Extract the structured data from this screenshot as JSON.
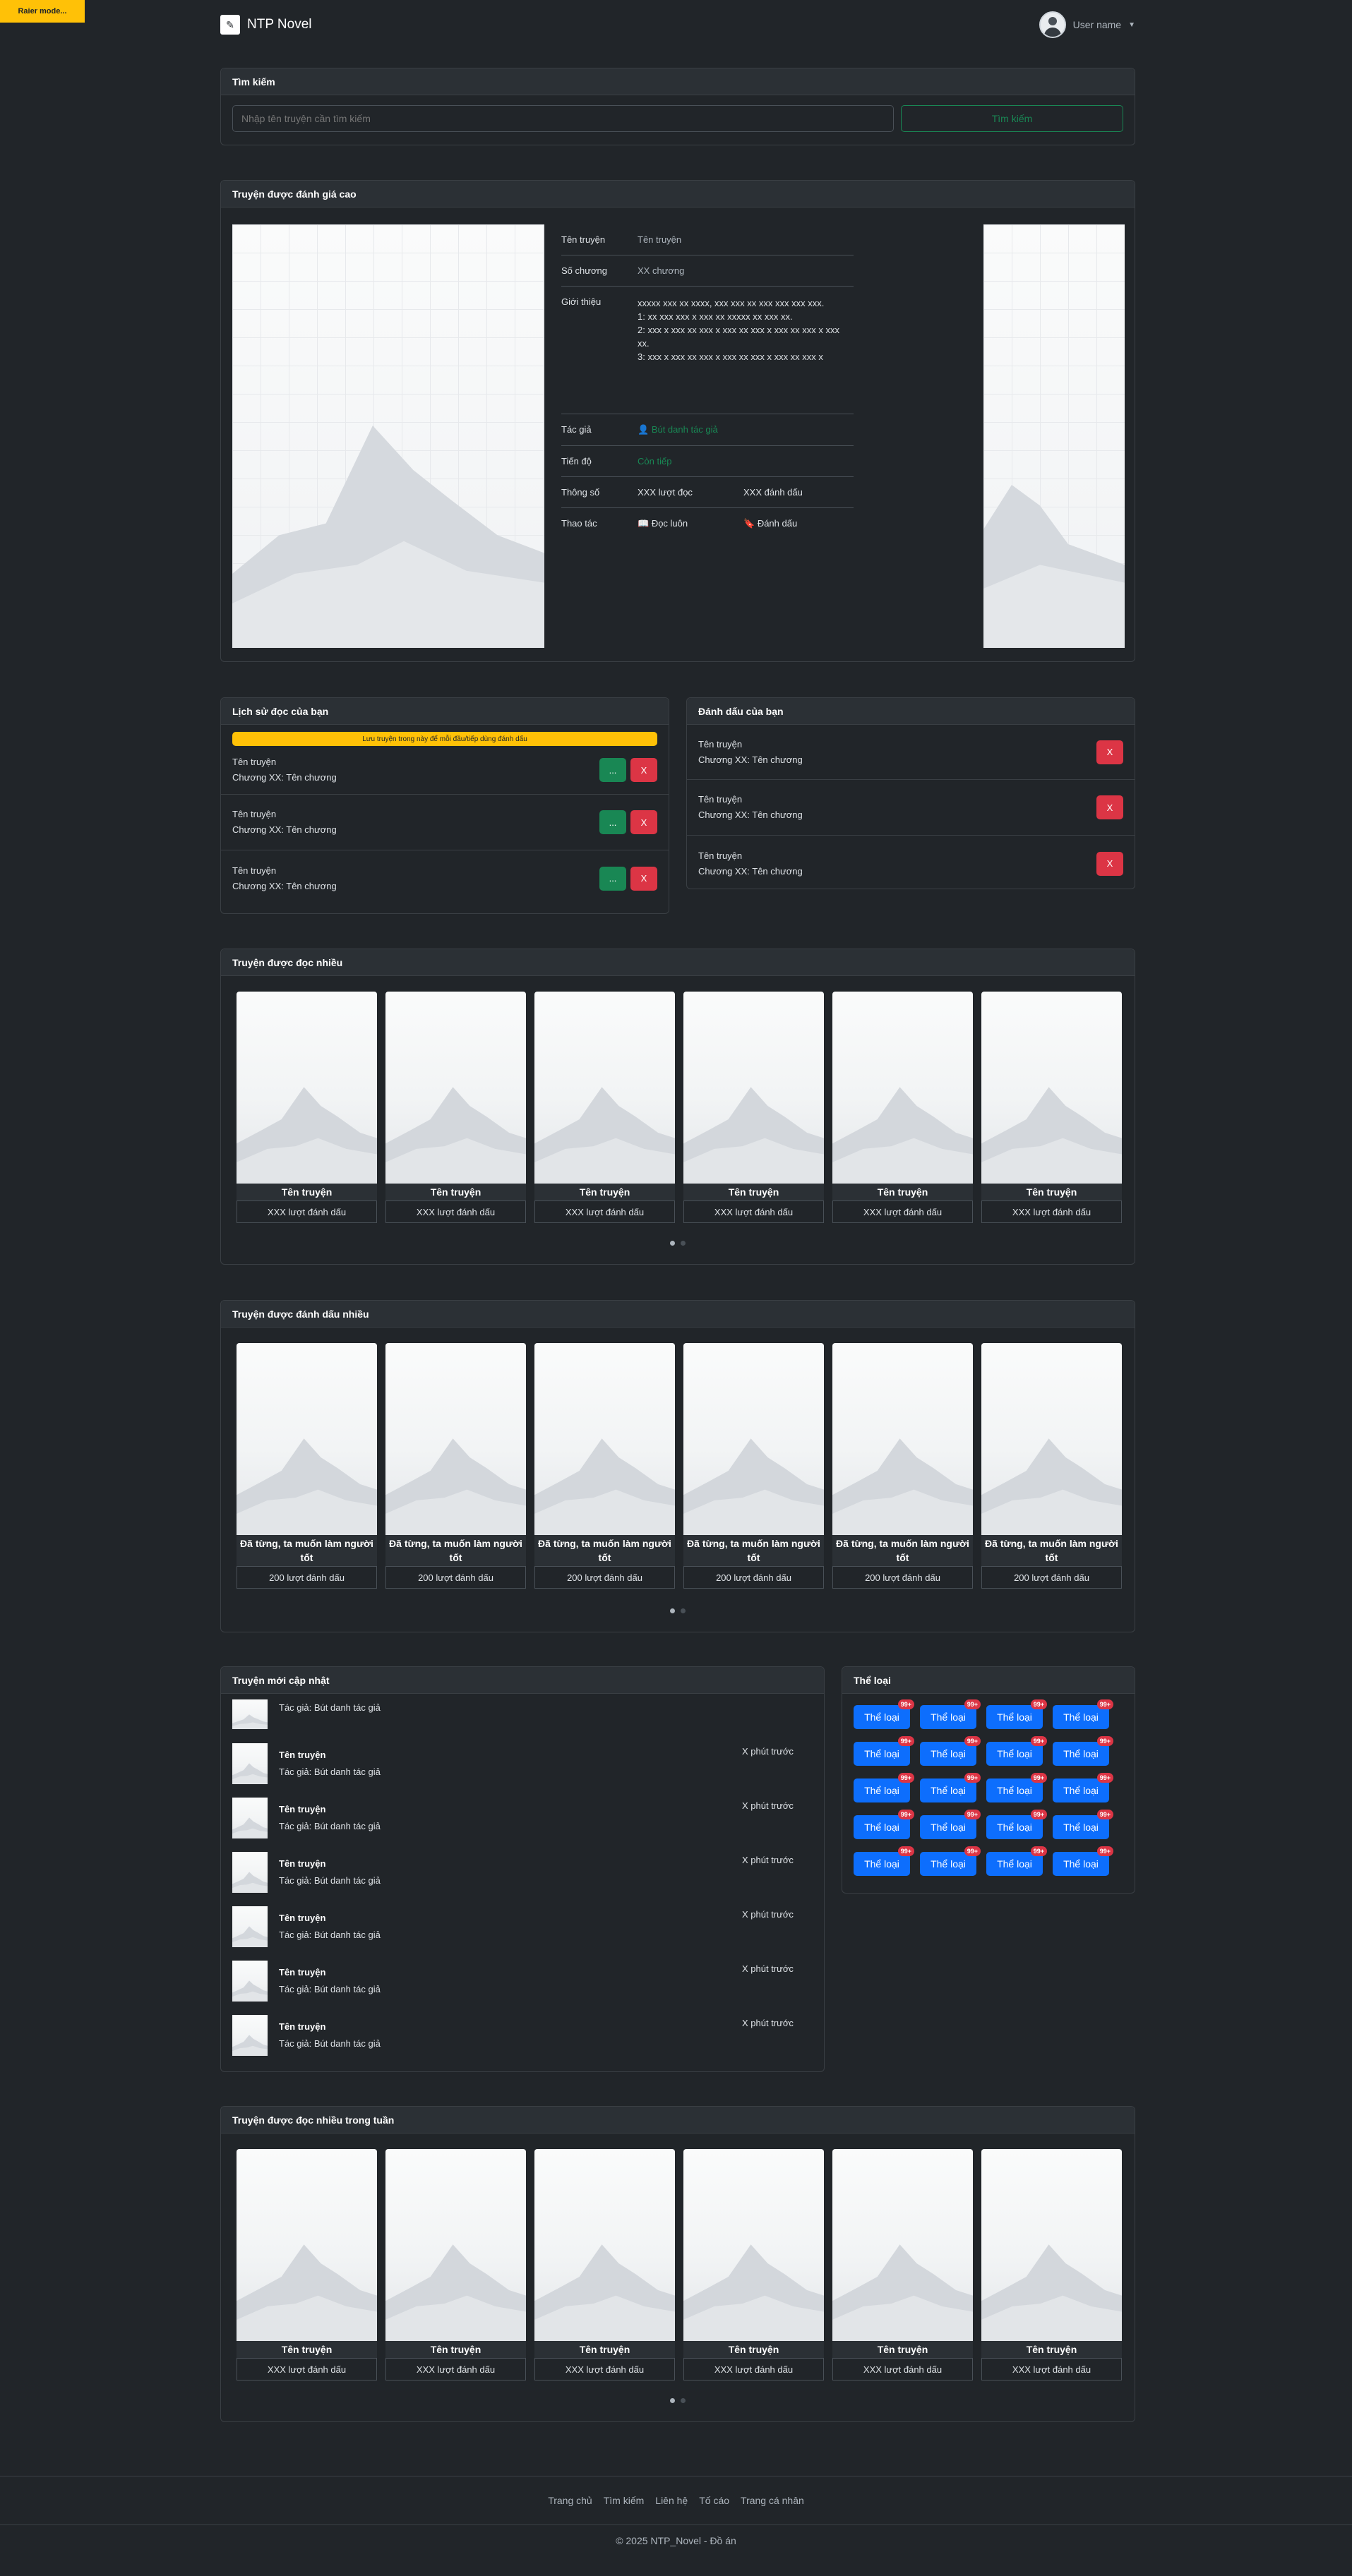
{
  "raier": "Raier mode...",
  "nav": {
    "brand": "NTP Novel",
    "user_name": "User name"
  },
  "search": {
    "title": "Tìm kiếm",
    "placeholder": "Nhập tên truyện cần tìm kiếm",
    "button": "Tìm kiếm"
  },
  "featured": {
    "title": "Truyện được đánh giá cao",
    "labels": {
      "name": "Tên truyện",
      "chapters": "Số chương",
      "intro": "Giới thiệu",
      "author": "Tác giả",
      "progress": "Tiến độ",
      "stats": "Thông số",
      "actions": "Thao tác"
    },
    "name": "Tên truyện",
    "chapters": "XX chương",
    "intro_lines": [
      "xxxxx xxx xx xxxx, xxx xxx xx xxx xxx xxx xxx.",
      "1: xx xxx xxx x xxx xx xxxxx xx xxx xx.",
      "2: xxx x xxx xx xxx x xxx xx xxx x xxx xx xxx x xxx xx.",
      "3: xxx x xxx xx xxx x xxx xx xxx x xxx xx xxx x"
    ],
    "author": "Bút danh tác giả",
    "progress": "Còn tiếp",
    "views": "XXX lượt đọc",
    "bookmarks": "XXX đánh dấu",
    "read_label": "Đọc luôn",
    "bookmark_label": "Đánh dấu"
  },
  "history": {
    "title": "Lịch sử đọc của bạn",
    "warning": "Lưu truyện trong này để mỗi đầu/tiếp dùng đánh dấu",
    "items": [
      {
        "name": "Tên truyện",
        "chapter": "Chương XX: Tên chương"
      },
      {
        "name": "Tên truyện",
        "chapter": "Chương XX: Tên chương"
      },
      {
        "name": "Tên truyện",
        "chapter": "Chương XX: Tên chương"
      }
    ],
    "continue_label": "...",
    "remove_label": "X"
  },
  "bookmarks": {
    "title": "Đánh dấu của bạn",
    "items": [
      {
        "name": "Tên truyện",
        "chapter": "Chương XX: Tên chương"
      },
      {
        "name": "Tên truyện",
        "chapter": "Chương XX: Tên chương"
      },
      {
        "name": "Tên truyện",
        "chapter": "Chương XX: Tên chương"
      }
    ],
    "remove_label": "X"
  },
  "most_read": {
    "title": "Truyện được đọc nhiều",
    "books": [
      {
        "name": "Tên truyện",
        "stat": "XXX lượt đánh dấu"
      },
      {
        "name": "Tên truyện",
        "stat": "XXX lượt đánh dấu"
      },
      {
        "name": "Tên truyện",
        "stat": "XXX lượt đánh dấu"
      },
      {
        "name": "Tên truyện",
        "stat": "XXX lượt đánh dấu"
      },
      {
        "name": "Tên truyện",
        "stat": "XXX lượt đánh dấu"
      },
      {
        "name": "Tên truyện",
        "stat": "XXX lượt đánh dấu"
      }
    ]
  },
  "most_bookmarked": {
    "title": "Truyện được đánh dấu nhiều",
    "books": [
      {
        "name": "Đã từng, ta muốn làm người tốt",
        "stat": "200 lượt đánh dấu"
      },
      {
        "name": "Đã từng, ta muốn làm người tốt",
        "stat": "200 lượt đánh dấu"
      },
      {
        "name": "Đã từng, ta muốn làm người tốt",
        "stat": "200 lượt đánh dấu"
      },
      {
        "name": "Đã từng, ta muốn làm người tốt",
        "stat": "200 lượt đánh dấu"
      },
      {
        "name": "Đã từng, ta muốn làm người tốt",
        "stat": "200 lượt đánh dấu"
      },
      {
        "name": "Đã từng, ta muốn làm người tốt",
        "stat": "200 lượt đánh dấu"
      }
    ]
  },
  "new_updates": {
    "title": "Truyện mới cập nhật",
    "items": [
      {
        "name": "",
        "author": "Tác giả: Bút danh tác giả",
        "time": ""
      },
      {
        "name": "Tên truyện",
        "author": "Tác giả: Bút danh tác giả",
        "time": "X phút trước"
      },
      {
        "name": "Tên truyện",
        "author": "Tác giả: Bút danh tác giả",
        "time": "X phút trước"
      },
      {
        "name": "Tên truyện",
        "author": "Tác giả: Bút danh tác giả",
        "time": "X phút trước"
      },
      {
        "name": "Tên truyện",
        "author": "Tác giả: Bút danh tác giả",
        "time": "X phút trước"
      },
      {
        "name": "Tên truyện",
        "author": "Tác giả: Bút danh tác giả",
        "time": "X phút trước"
      },
      {
        "name": "Tên truyện",
        "author": "Tác giả: Bút danh tác giả",
        "time": "X phút trước"
      }
    ]
  },
  "genres": {
    "title": "Thể loại",
    "label": "Thể loại",
    "badge": "99+",
    "count": 20
  },
  "weekly": {
    "title": "Truyện được đọc nhiều trong tuần",
    "books": [
      {
        "name": "Tên truyện",
        "stat": "XXX lượt đánh dấu"
      },
      {
        "name": "Tên truyện",
        "stat": "XXX lượt đánh dấu"
      },
      {
        "name": "Tên truyện",
        "stat": "XXX lượt đánh dấu"
      },
      {
        "name": "Tên truyện",
        "stat": "XXX lượt đánh dấu"
      },
      {
        "name": "Tên truyện",
        "stat": "XXX lượt đánh dấu"
      },
      {
        "name": "Tên truyện",
        "stat": "XXX lượt đánh dấu"
      }
    ]
  },
  "footer": {
    "links": [
      "Trang chủ",
      "Tìm kiếm",
      "Liên hệ",
      "Tố cáo",
      "Trang cá nhân"
    ],
    "copyright": "© 2025 NTP_Novel - Đồ án"
  },
  "colors": {
    "bg": "#212529",
    "green": "#198754",
    "red": "#dc3545",
    "blue": "#0d6efd",
    "yellow": "#ffc107"
  }
}
